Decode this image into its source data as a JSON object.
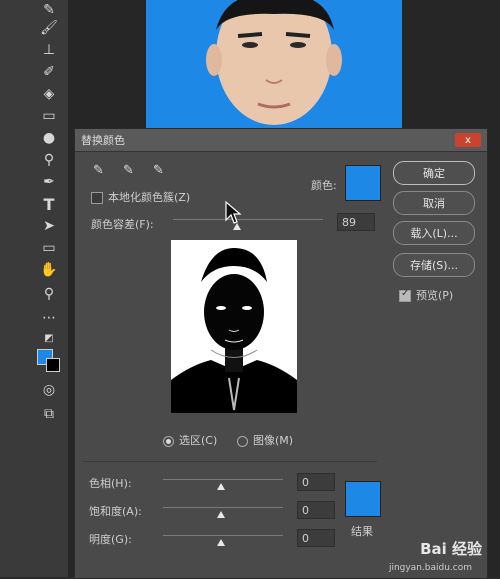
{
  "dialog": {
    "title": "替换颜色",
    "close_label": "x",
    "localized_label": "本地化颜色簇(Z)",
    "color_label": "颜色:",
    "fuzziness_label": "颜色容差(F):",
    "fuzziness_value": "89",
    "selection_label": "选区(C)",
    "image_label": "图像(M)",
    "hue_label": "色相(H):",
    "hue_value": "0",
    "saturation_label": "饱和度(A):",
    "saturation_value": "0",
    "lightness_label": "明度(G):",
    "lightness_value": "0",
    "result_label": "结果",
    "buttons": {
      "ok": "确定",
      "cancel": "取消",
      "load": "载入(L)...",
      "save": "存储(S)..."
    },
    "preview_label": "预览(P)",
    "preview_checked": true,
    "selected_color": "#1e88e6"
  },
  "toolbar": {
    "tools": [
      "brush-icon",
      "stamp-icon",
      "history-brush-icon",
      "eraser-icon",
      "gradient-icon",
      "blur-icon",
      "dodge-icon",
      "pen-icon",
      "type-icon",
      "path-select-icon",
      "rectangle-icon",
      "hand-icon",
      "zoom-icon",
      "more-icon",
      "swap-colors-icon",
      "color-swatch",
      "quick-mask-icon",
      "screen-mode-icon"
    ]
  },
  "watermark": {
    "text": "Bai 经验",
    "sub": "jingyan.baidu.com"
  }
}
